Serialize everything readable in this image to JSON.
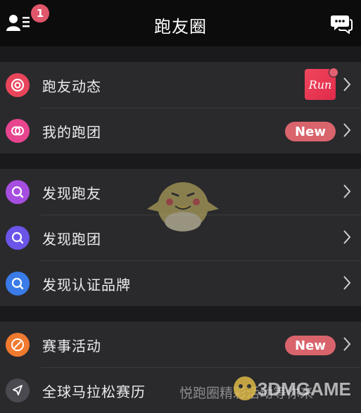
{
  "header": {
    "title": "跑友圈",
    "notification_count": "1",
    "left_icon": "contacts-list-icon",
    "right_icon": "chat-bubbles-icon"
  },
  "section1": {
    "items": [
      {
        "label": "跑友动态",
        "icon": "target-icon",
        "color": "#e8455b",
        "extra": "Run"
      },
      {
        "label": "我的跑团",
        "icon": "linked-circles-icon",
        "color": "#e8458f",
        "badge": "New"
      }
    ]
  },
  "section2": {
    "items": [
      {
        "label": "发现跑友",
        "icon": "search-icon",
        "color": "#a64ee0"
      },
      {
        "label": "发现跑团",
        "icon": "search-icon",
        "color": "#6a55e8"
      },
      {
        "label": "发现认证品牌",
        "icon": "search-icon",
        "color": "#3a7be8"
      }
    ]
  },
  "section3": {
    "items": [
      {
        "label": "赛事活动",
        "icon": "compass-icon",
        "color": "#f07a2f",
        "badge": "New"
      },
      {
        "label": "全球马拉松赛历",
        "icon": "location-arrow-icon",
        "color": "#4a4a50"
      }
    ]
  },
  "watermark": {
    "text": "悦跑圈精彩活动等你来",
    "logo": "3DMGAME"
  },
  "colors": {
    "background": "#1a1a1c",
    "header": "#0c0c0c",
    "row": "#2a2a2d",
    "badge": "#d9646c"
  }
}
